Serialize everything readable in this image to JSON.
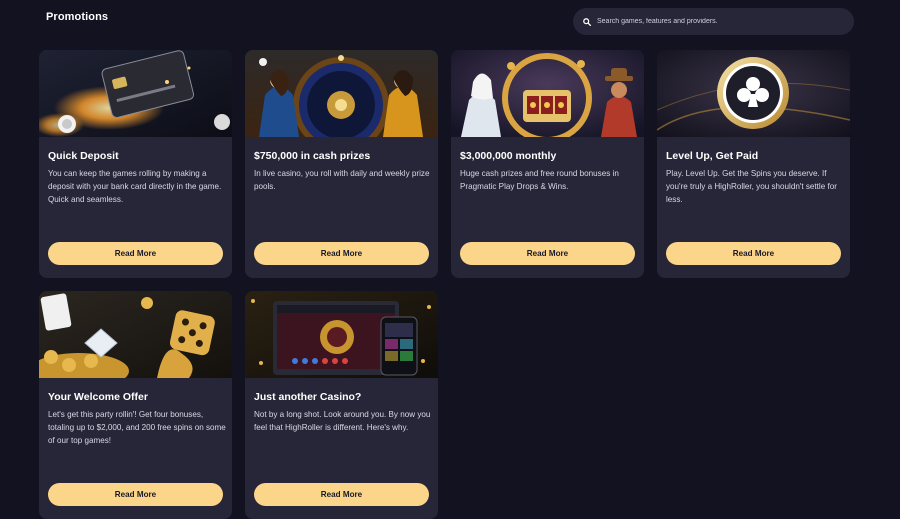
{
  "header": {
    "title": "Promotions",
    "search_placeholder": "Search games, features and providers."
  },
  "cards": [
    {
      "title": "Quick Deposit",
      "description": "You can keep the games rolling by making a deposit with your bank card directly in the game. Quick and seamless.",
      "button_label": "Read More",
      "image_icon": "flaming-bank-card-image"
    },
    {
      "title": "$750,000 in cash prizes",
      "description": "In live casino, you roll with daily and weekly prize pools.",
      "button_label": "Read More",
      "image_icon": "live-casino-roulette-hosts-image"
    },
    {
      "title": "$3,000,000 monthly",
      "description": "Huge cash prizes and free round bonuses in Pragmatic Play Drops & Wins.",
      "button_label": "Read More",
      "image_icon": "slot-machine-characters-image"
    },
    {
      "title": "Level Up, Get Paid",
      "description": "Play. Level Up. Get the Spins you deserve. If you're truly a HighRoller, you shouldn't settle for less.",
      "button_label": "Read More",
      "image_icon": "club-suit-coin-image"
    },
    {
      "title": "Your Welcome Offer",
      "description": "Let's get this party rollin'! Get four bonuses, totaling up to $2,000, and 200 free spins on some of our top games!",
      "button_label": "Read More",
      "image_icon": "golden-dice-coins-image"
    },
    {
      "title": "Just another Casino?",
      "description": "Not by a long shot. Look around you. By now you feel that HighRoller is different. Here's why.",
      "button_label": "Read More",
      "image_icon": "laptop-phone-casino-image"
    }
  ],
  "colors": {
    "background": "#121220",
    "card": "#262638",
    "button": "#fbd58a",
    "accent_gold": "#d9a441"
  }
}
